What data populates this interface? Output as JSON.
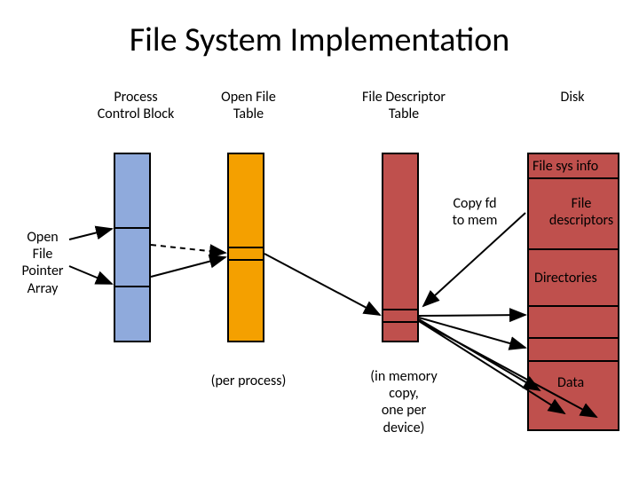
{
  "title": "File System Implementation",
  "columns": {
    "pcb": "Process\nControl Block",
    "oft": "Open File\nTable",
    "fdt": "File Descriptor\nTable",
    "disk": "Disk"
  },
  "side_label": "Open\nFile\nPointer\nArray",
  "bottom_labels": {
    "oft": "(per process)",
    "fdt": "(in memory\ncopy,\none per\ndevice)"
  },
  "inline_labels": {
    "copy_fd": "Copy fd\nto mem"
  },
  "disk_sections": {
    "fsinfo": "File sys info",
    "filedesc": "File\ndescriptors",
    "dirs": "Directories",
    "data": "Data"
  }
}
